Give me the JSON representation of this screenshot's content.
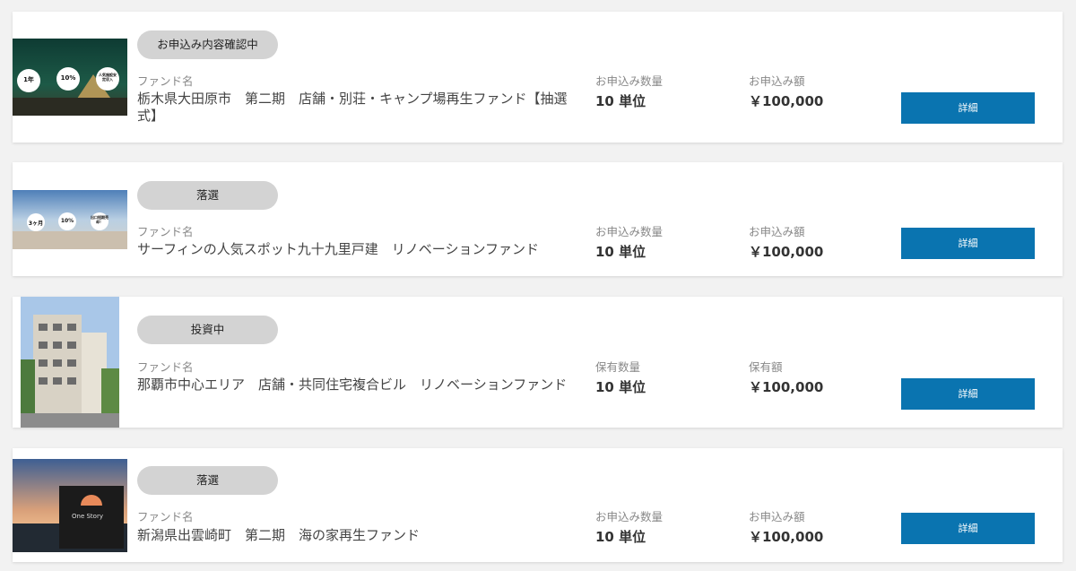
{
  "cards": [
    {
      "status": "お申込み内容確認中",
      "fund_label": "ファンド名",
      "fund_name": "栃木県大田原市　第二期　店舗・別荘・キャンプ場再生ファンド【抽選式】",
      "qty_label": "お申込み数量",
      "qty": "10 単位",
      "amount_label": "お申込み額",
      "amount": "￥100,000",
      "button": "詳細",
      "thumb_badges": [
        "1年",
        "10%",
        "人気施設安定収入"
      ]
    },
    {
      "status": "落選",
      "fund_label": "ファンド名",
      "fund_name": "サーフィンの人気スポット九十九里戸建　リノベーションファンド",
      "qty_label": "お申込み数量",
      "qty": "10 単位",
      "amount_label": "お申込み額",
      "amount": "￥100,000",
      "button": "詳細",
      "thumb_badges": [
        "3ヶ月",
        "10%",
        "出口短期売却！"
      ]
    },
    {
      "status": "投資中",
      "fund_label": "ファンド名",
      "fund_name": "那覇市中心エリア　店舗・共同住宅複合ビル　リノベーションファンド",
      "qty_label": "保有数量",
      "qty": "10 単位",
      "amount_label": "保有額",
      "amount": "￥100,000",
      "button": "詳細"
    },
    {
      "status": "落選",
      "fund_label": "ファンド名",
      "fund_name": "新潟県出雲崎町　第二期　海の家再生ファンド",
      "qty_label": "お申込み数量",
      "qty": "10 単位",
      "amount_label": "お申込み額",
      "amount": "￥100,000",
      "button": "詳細",
      "thumb_text": "One Story"
    }
  ]
}
